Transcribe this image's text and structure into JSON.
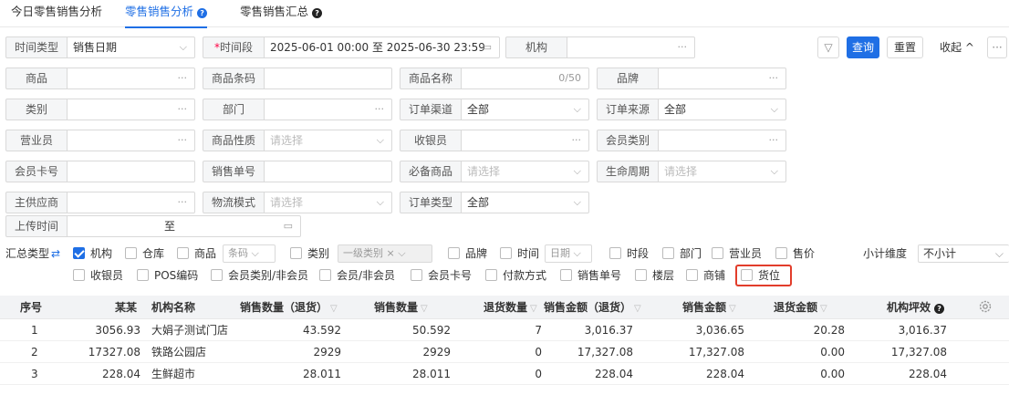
{
  "tabs": [
    {
      "label": "今日零售销售分析",
      "active": false,
      "help": false
    },
    {
      "label": "零售销售分析",
      "active": true,
      "help": true
    },
    {
      "label": "零售销售汇总",
      "active": false,
      "help": true
    }
  ],
  "filters": {
    "time_type": {
      "label": "时间类型",
      "value": "销售日期"
    },
    "period": {
      "label": "时间段",
      "value": "2025-06-01 00:00 至 2025-06-30 23:59"
    },
    "org": {
      "label": "机构",
      "suffix": "···"
    },
    "product": {
      "label": "商品",
      "suffix": "···"
    },
    "barcode": {
      "label": "商品条码"
    },
    "product_name": {
      "label": "商品名称",
      "counter": "0/50"
    },
    "brand": {
      "label": "品牌",
      "suffix": "···"
    },
    "category": {
      "label": "类别",
      "suffix": "···"
    },
    "dept": {
      "label": "部门",
      "suffix": "···"
    },
    "order_channel": {
      "label": "订单渠道",
      "value": "全部"
    },
    "order_source": {
      "label": "订单来源",
      "value": "全部"
    },
    "clerk": {
      "label": "营业员",
      "suffix": "···"
    },
    "product_nature": {
      "label": "商品性质",
      "placeholder": "请选择"
    },
    "cashier": {
      "label": "收银员",
      "suffix": "···"
    },
    "member_type": {
      "label": "会员类别",
      "suffix": "···"
    },
    "member_card": {
      "label": "会员卡号"
    },
    "sales_no": {
      "label": "销售单号"
    },
    "must_product": {
      "label": "必备商品",
      "placeholder": "请选择"
    },
    "lifecycle": {
      "label": "生命周期",
      "placeholder": "请选择"
    },
    "main_supplier": {
      "label": "主供应商",
      "suffix": "···"
    },
    "logistics": {
      "label": "物流模式",
      "placeholder": "请选择"
    },
    "order_type": {
      "label": "订单类型",
      "value": "全部"
    },
    "upload_time": {
      "label": "上传时间",
      "value": "至"
    }
  },
  "actions": {
    "query": "查询",
    "reset": "重置",
    "collapse": "收起 ^",
    "more": "···"
  },
  "summary": {
    "label": "汇总类型",
    "row1": [
      {
        "label": "机构",
        "checked": true
      },
      {
        "label": "仓库",
        "checked": false
      },
      {
        "label": "商品",
        "checked": false,
        "select": "条码"
      },
      {
        "label": "类别",
        "checked": false,
        "select": "一级类别"
      },
      {
        "label": "品牌",
        "checked": false
      },
      {
        "label": "时间",
        "checked": false,
        "select": "日期"
      },
      {
        "label": "时段",
        "checked": false
      },
      {
        "label": "部门",
        "checked": false
      },
      {
        "label": "营业员",
        "checked": false
      },
      {
        "label": "售价",
        "checked": false
      }
    ],
    "row2": [
      {
        "label": "收银员",
        "checked": false
      },
      {
        "label": "POS编码",
        "checked": false
      },
      {
        "label": "会员类别/非会员",
        "checked": false
      },
      {
        "label": "会员/非会员",
        "checked": false
      },
      {
        "label": "会员卡号",
        "checked": false
      },
      {
        "label": "付款方式",
        "checked": false
      },
      {
        "label": "销售单号",
        "checked": false
      },
      {
        "label": "楼层",
        "checked": false
      },
      {
        "label": "商铺",
        "checked": false
      },
      {
        "label": "货位",
        "checked": false
      }
    ],
    "subtotal_label": "小计维度",
    "subtotal_value": "不小计"
  },
  "table": {
    "columns": [
      "序号",
      "某某",
      "机构名称",
      "销售数量（退货）",
      "销售数量",
      "退货数量",
      "销售金额（退货）",
      "销售金额",
      "退货金额",
      "机构坪效"
    ],
    "rows": [
      [
        "1",
        "3056.93",
        "大娟子测试门店",
        "43.592",
        "50.592",
        "7",
        "3,016.37",
        "3,036.65",
        "20.28",
        "3,016.37"
      ],
      [
        "2",
        "17327.08",
        "铁路公园店",
        "2929",
        "2929",
        "0",
        "17,327.08",
        "17,327.08",
        "0.00",
        "17,327.08"
      ],
      [
        "3",
        "228.04",
        "生鲜超市",
        "28.011",
        "28.011",
        "0",
        "228.04",
        "228.04",
        "0.00",
        "228.04"
      ]
    ]
  },
  "colors": {
    "accent": "#1f6fe5",
    "highlight": "#e23d2b"
  }
}
